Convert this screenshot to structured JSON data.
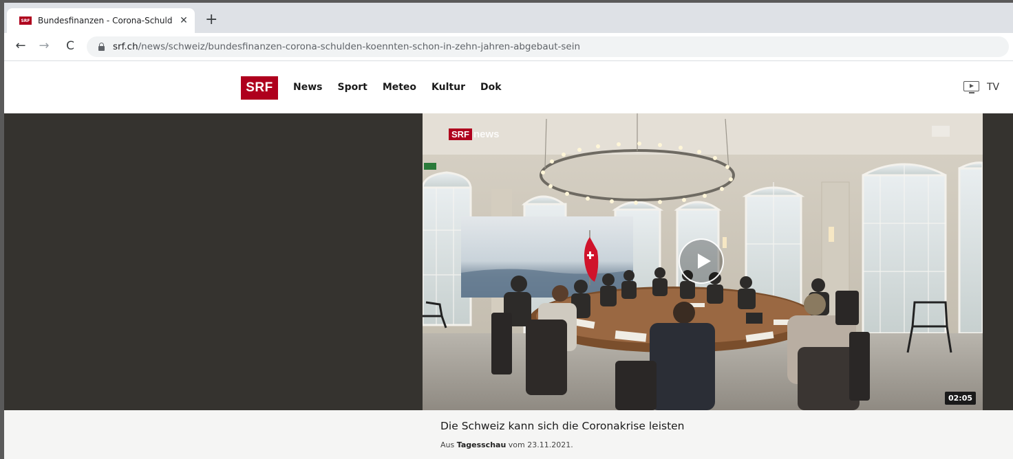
{
  "browser": {
    "tab_title": "Bundesfinanzen - Corona-Schuld",
    "favicon_text": "SRF",
    "tab_close": "✕",
    "new_tab": "+",
    "url_host": "srf.ch",
    "url_path": "/news/schweiz/bundesfinanzen-corona-schulden-koennten-schon-in-zehn-jahren-abgebaut-sein"
  },
  "header": {
    "logo": "SRF",
    "nav": [
      "News",
      "Sport",
      "Meteo",
      "Kultur",
      "Dok"
    ],
    "tv_label": "TV"
  },
  "video": {
    "badge_brand": "SRF",
    "badge_news": "news",
    "duration": "02:05",
    "title": "Die Schweiz kann sich die Coronakrise leisten",
    "meta_prefix": "Aus",
    "meta_show": "Tagesschau",
    "meta_suffix": "vom 23.11.2021."
  },
  "colors": {
    "brand_red": "#af001d",
    "stage_bg": "#35332f"
  }
}
